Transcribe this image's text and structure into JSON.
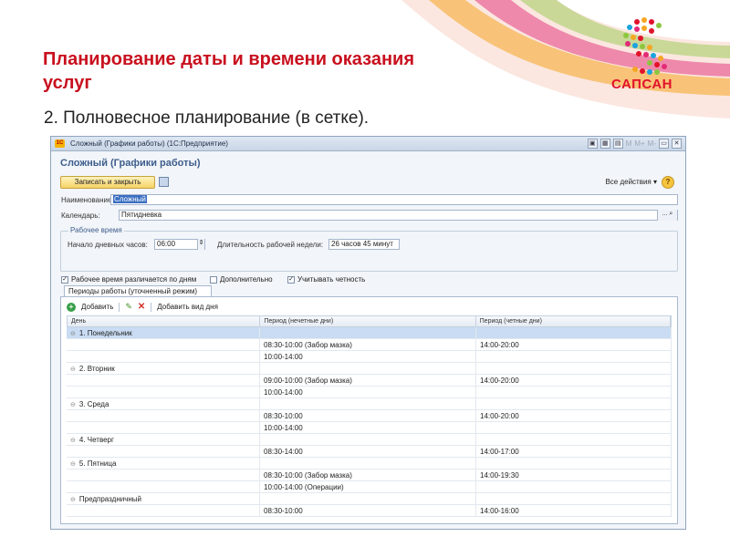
{
  "slide": {
    "title": "Планирование даты и времени оказания услуг",
    "subtitle": "2.   Полновесное планирование (в сетке).",
    "logo_text": "САПСАН",
    "colors": {
      "title": "#c8101e",
      "logo": "#e2122b"
    }
  },
  "window": {
    "title": "Сложный (Графики работы)  (1С:Предприятие)",
    "tb_m": "M",
    "tb_mplus": "M+",
    "tb_mminus": "M-",
    "form_title": "Сложный (Графики работы)",
    "save_close": "Записать и закрыть",
    "all_actions": "Все действия ▾",
    "help": "?",
    "name_label": "Наименование:",
    "name_value": "Сложный",
    "calendar_label": "Календарь:",
    "calendar_value": "Пятидневка",
    "calendar_btn": "...",
    "work_group": "Рабочее время",
    "start_label": "Начало дневных часов:",
    "start_value": "06:00",
    "duration_label": "Длительность рабочей недели:",
    "duration_value": "26 часов 45 минут",
    "chk_diff": "Рабочее время различается по дням",
    "chk_extra": "Дополнительно",
    "chk_parity": "Учитывать четность",
    "tab": "Периоды работы (уточненный режим)",
    "add": "Добавить",
    "add_day": "Добавить вид дня",
    "headers": [
      "День",
      "Период (нечетные дни)",
      "Период (четные дни)"
    ],
    "rows": [
      {
        "day": "1. Понедельник",
        "odd": "",
        "even": "",
        "group": true
      },
      {
        "day": "",
        "odd": "08:30-10:00 (Забор мазка)",
        "even": "14:00-20:00"
      },
      {
        "day": "",
        "odd": "10:00-14:00",
        "even": ""
      },
      {
        "day": "2. Вторник",
        "odd": "",
        "even": "",
        "group": true
      },
      {
        "day": "",
        "odd": "09:00-10:00 (Забор мазка)",
        "even": "14:00-20:00"
      },
      {
        "day": "",
        "odd": "10:00-14:00",
        "even": ""
      },
      {
        "day": "3. Среда",
        "odd": "",
        "even": "",
        "group": true
      },
      {
        "day": "",
        "odd": "08:30-10:00",
        "even": "14:00-20:00"
      },
      {
        "day": "",
        "odd": "10:00-14:00",
        "even": ""
      },
      {
        "day": "4. Четверг",
        "odd": "",
        "even": "",
        "group": true
      },
      {
        "day": "",
        "odd": "08:30-14:00",
        "even": "14:00-17:00"
      },
      {
        "day": "5. Пятница",
        "odd": "",
        "even": "",
        "group": true
      },
      {
        "day": "",
        "odd": "08:30-10:00 (Забор мазка)",
        "even": "14:00-19:30"
      },
      {
        "day": "",
        "odd": "10:00-14:00 (Операции)",
        "even": ""
      },
      {
        "day": "Предпраздничный",
        "odd": "",
        "even": "",
        "group": true
      },
      {
        "day": "",
        "odd": "08:30-10:00",
        "even": "14:00-16:00"
      }
    ]
  }
}
